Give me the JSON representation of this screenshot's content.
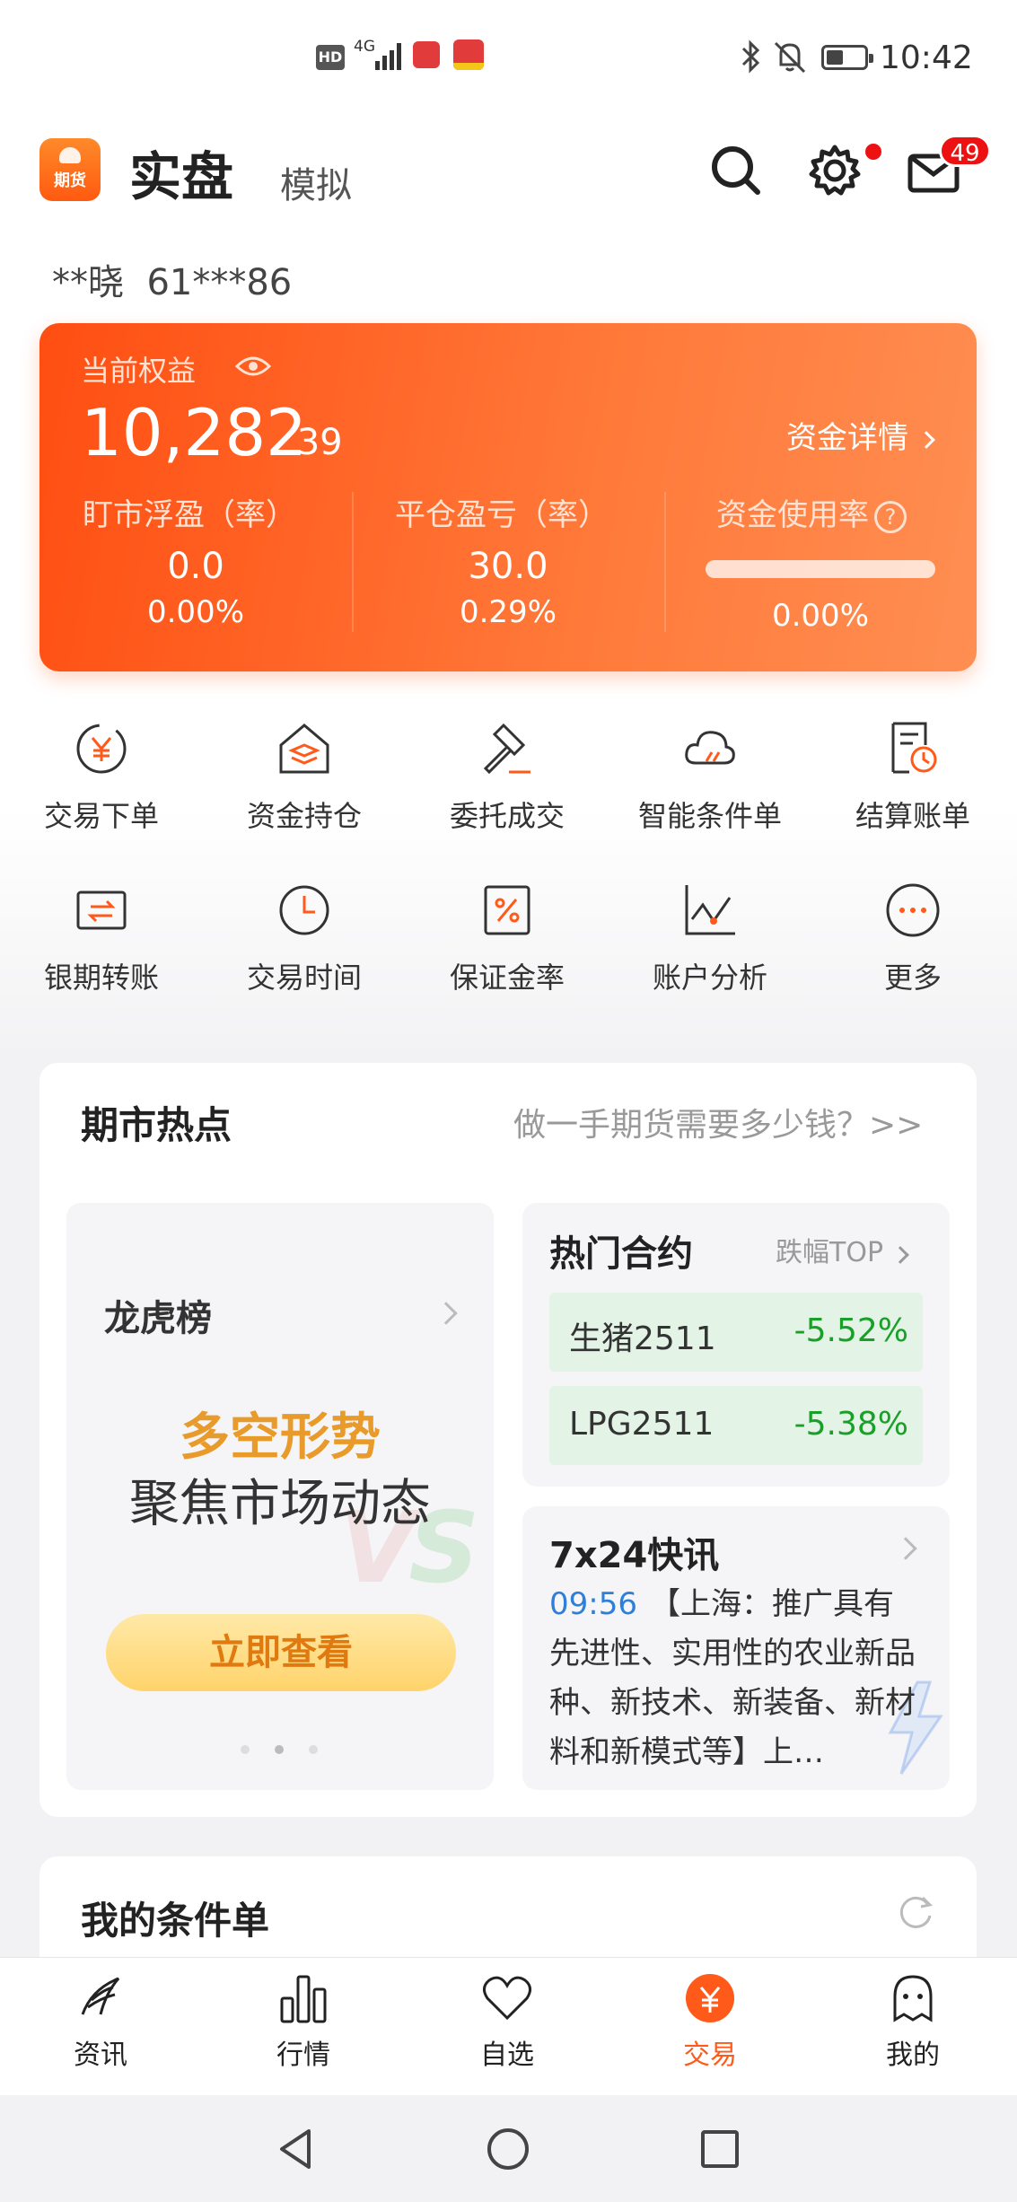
{
  "status_bar": {
    "time": "10:42",
    "hd": "HD",
    "network": "4G"
  },
  "header": {
    "logo_text": "期货",
    "title": "实盘",
    "alt_mode": "模拟",
    "mail_badge": "49"
  },
  "account": {
    "name": "**晓",
    "id": "61***86"
  },
  "equity_card": {
    "label": "当前权益",
    "value_int": "10,282",
    "value_dec": ".39",
    "detail_link": "资金详情",
    "cols": [
      {
        "label": "盯市浮盈（率）",
        "value": "0.0",
        "pct": "0.00%"
      },
      {
        "label": "平仓盈亏（率）",
        "value": "30.0",
        "pct": "0.29%"
      },
      {
        "label": "资金使用率",
        "help": "?",
        "pct": "0.00%",
        "usage_fraction": 0.0
      }
    ]
  },
  "quick_grid": [
    {
      "label": "交易下单",
      "icon": "yen-exchange-icon"
    },
    {
      "label": "资金持仓",
      "icon": "layers-house-icon"
    },
    {
      "label": "委托成交",
      "icon": "gavel-icon"
    },
    {
      "label": "智能条件单",
      "icon": "cloud-icon"
    },
    {
      "label": "结算账单",
      "icon": "bill-clock-icon"
    },
    {
      "label": "银期转账",
      "icon": "card-transfer-icon"
    },
    {
      "label": "交易时间",
      "icon": "clock-icon"
    },
    {
      "label": "保证金率",
      "icon": "percent-doc-icon"
    },
    {
      "label": "账户分析",
      "icon": "line-chart-icon"
    },
    {
      "label": "更多",
      "icon": "more-dots-icon"
    }
  ],
  "hot": {
    "title": "期市热点",
    "link": "做一手期货需要多少钱？>>",
    "dragon_tiger": {
      "title": "龙虎榜",
      "line1": "多空形势",
      "line2": "聚焦市场动态",
      "button": "立即查看"
    },
    "hot_contracts": {
      "title": "热门合约",
      "sub": "跌幅TOP",
      "rows": [
        {
          "name": "生猪2511",
          "pct": "-5.52%"
        },
        {
          "name": "LPG2511",
          "pct": "-5.38%"
        }
      ]
    },
    "news": {
      "title": "7x24快讯",
      "time": "09:56",
      "text": "【上海：推广具有先进性、实用性的农业新品种、新技术、新装备、新材料和新模式等】上…"
    }
  },
  "conditions": {
    "title": "我的条件单"
  },
  "tabs": [
    {
      "label": "资讯",
      "icon": "news-icon",
      "active": false
    },
    {
      "label": "行情",
      "icon": "bars-icon",
      "active": false
    },
    {
      "label": "自选",
      "icon": "heart-icon",
      "active": false
    },
    {
      "label": "交易",
      "icon": "trade-yen-icon",
      "active": true
    },
    {
      "label": "我的",
      "icon": "profile-icon",
      "active": false
    }
  ],
  "colors": {
    "brand": "#ff5a1a",
    "up": "#18a028",
    "link_blue": "#2d7fd8"
  }
}
